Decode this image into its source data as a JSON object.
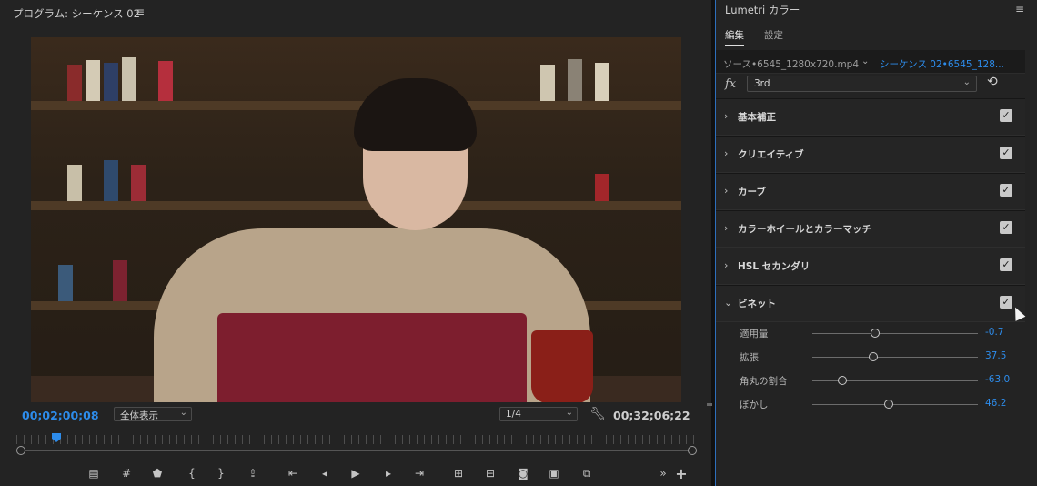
{
  "program": {
    "title": "プログラム: シーケンス 02",
    "menu_icon": "≡",
    "timecode_current": "00;02;00;08",
    "zoom_select": "全体表示",
    "resolution_select": "1/4",
    "timecode_duration": "00;32;06;22",
    "transport_icons": [
      "marker-icon",
      "grid-icon",
      "marker-shield-icon",
      "in-point-icon",
      "out-point-icon",
      "export-frame-icon",
      "go-to-in-icon",
      "step-back-icon",
      "play-icon",
      "step-forward-icon",
      "go-to-out-icon",
      "insert-icon",
      "overwrite-icon",
      "camera-icon",
      "comparison-view-icon",
      "settings-toggle-icon",
      "more-icon",
      "add-icon"
    ]
  },
  "lumetri": {
    "title": "Lumetri カラー",
    "menu_icon": "≡",
    "tabs": [
      {
        "label": "編集",
        "active": true
      },
      {
        "label": "設定",
        "active": false
      }
    ],
    "source_label": "ソース•6545_1280x720.mp4",
    "sequence_label": "シーケンス 02•6545_128...",
    "fx_label": "fx",
    "preset_value": "3rd",
    "sections": [
      {
        "label": "基本補正",
        "expanded": false,
        "enabled": true
      },
      {
        "label": "クリエイティブ",
        "expanded": false,
        "enabled": true
      },
      {
        "label": "カーブ",
        "expanded": false,
        "enabled": true
      },
      {
        "label": "カラーホイールとカラーマッチ",
        "expanded": false,
        "enabled": true
      },
      {
        "label": "HSL セカンダリ",
        "expanded": false,
        "enabled": true
      },
      {
        "label": "ビネット",
        "expanded": true,
        "enabled": true
      }
    ],
    "vignette_params": [
      {
        "label": "適用量",
        "value": "-0.7",
        "slider": 0.38
      },
      {
        "label": "拡張",
        "value": "37.5",
        "slider": 0.37
      },
      {
        "label": "角丸の割合",
        "value": "-63.0",
        "slider": 0.18
      },
      {
        "label": "ぼかし",
        "value": "46.2",
        "slider": 0.46
      }
    ]
  },
  "colors": {
    "accent": "#2d8ceb",
    "panel_bg": "#232323",
    "divider": "#111111"
  }
}
